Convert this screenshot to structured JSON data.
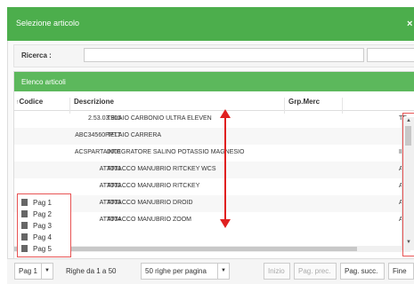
{
  "dialog": {
    "title": "Selezione articolo",
    "close_glyph": "×"
  },
  "search": {
    "label": "Ricerca :",
    "value": "",
    "placeholder": ""
  },
  "list": {
    "header": "Elenco articoli",
    "columns": {
      "sort_glyph": "↑",
      "codice": "Codice",
      "descrizione": "Descrizione",
      "grp_merc": "Grp.Merc"
    },
    "rows": [
      {
        "codice": "2.53.03.905",
        "descrizione": "TELAIO CARBONIO ULTRA ELEVEN",
        "extra": "TE"
      },
      {
        "codice": "ABC34560PPTT",
        "descrizione": "TELAIO CARRERA",
        "extra": ""
      },
      {
        "codice": "ACSPARTA0001",
        "descrizione": "INTEGRATORE SALINO POTASSIO MAGNESIO",
        "extra": "IN"
      },
      {
        "codice": "ATT001",
        "descrizione": "ATTACCO MANUBRIO RITCKEY WCS",
        "extra": "AT"
      },
      {
        "codice": "ATT002",
        "descrizione": "ATTACCO MANUBRIO RITCKEY",
        "extra": "AT"
      },
      {
        "codice": "ATT003",
        "descrizione": "ATTACCO MANUBRIO DROID",
        "extra": "AT"
      },
      {
        "codice": "ATT004",
        "descrizione": "ATTACCO MANUBRIO ZOOM",
        "extra": "AT"
      }
    ]
  },
  "page_menu": {
    "items": [
      "Pag 1",
      "Pag 2",
      "Pag 3",
      "Pag 4",
      "Pag 5"
    ]
  },
  "footer": {
    "page_select": "Pag 1",
    "rows_info": "Righe da 1 a 50",
    "per_page": "50 righe per pagina",
    "first": "Inizio",
    "prev": "Pag. prec.",
    "next": "Pag. succ.",
    "last": "Fine"
  },
  "icons": {
    "document": "document-icon",
    "caret": "caret-down-icon",
    "close": "close-icon",
    "sort": "sort-asc-icon"
  },
  "colors": {
    "header_green": "#4cae4c",
    "list_green": "#5cb85c",
    "annotation_red": "#e02020"
  }
}
